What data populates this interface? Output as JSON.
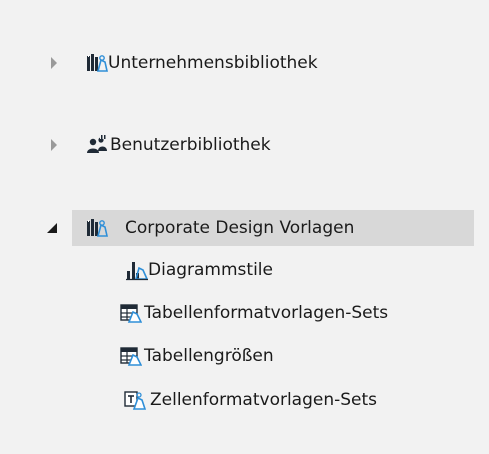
{
  "tree": {
    "nodes": [
      {
        "label": "Unternehmensbibliothek",
        "icon": "library-icon",
        "expanded": false
      },
      {
        "label": "Benutzerbibliothek",
        "icon": "users-icon",
        "expanded": false
      },
      {
        "label": "Corporate Design Vorlagen",
        "icon": "library-icon",
        "expanded": true,
        "selected": true,
        "children": [
          {
            "label": "Diagrammstile",
            "icon": "chart-style-icon"
          },
          {
            "label": "Tabellenformatvorlagen-Sets",
            "icon": "table-style-set-icon"
          },
          {
            "label": "Tabellengrößen",
            "icon": "table-size-icon"
          },
          {
            "label": "Zellenformatvorlagen-Sets",
            "icon": "cell-style-set-icon"
          }
        ]
      }
    ]
  },
  "colors": {
    "selection": "#d8d8d8",
    "icon_dark": "#1f2a36",
    "icon_blue": "#2f8fd8",
    "arrow_collapsed": "#9a9a9a",
    "arrow_expanded": "#1a1a1a"
  }
}
